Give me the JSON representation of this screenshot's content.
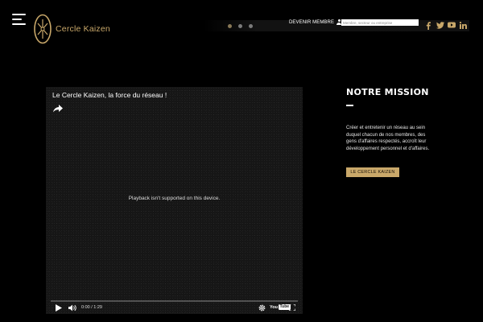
{
  "header": {
    "logo_text": "Cercle Kaizen",
    "member_link": "DEVENIR MEMBRE",
    "search_placeholder": "Membre, secteur ou entreprise",
    "slider_dots": [
      {
        "state": "active"
      },
      {
        "state": "inactive"
      },
      {
        "state": "inactive"
      }
    ],
    "social": [
      {
        "icon": "facebook-icon"
      },
      {
        "icon": "twitter-icon"
      },
      {
        "icon": "youtube-icon"
      },
      {
        "icon": "linkedin-icon"
      }
    ]
  },
  "video": {
    "title": "Le Cercle Kaizen, la force du réseau !",
    "message": "Playback isn't supported on this device.",
    "time": "0:00 / 1:29",
    "youtube_you": "You",
    "youtube_tube": "Tube"
  },
  "mission": {
    "title": "NOTRE MISSION",
    "text": "Créer et entretenir un réseau au sein duquel chacun de nos membres, des gens d'affaires respectés, accroît leur développement personnel et d'affaires.",
    "button_label": "LE CERCLE KAIZEN"
  },
  "colors": {
    "background": "#000000",
    "accent_gold": "#c9a86a",
    "video_bg": "#161616"
  }
}
